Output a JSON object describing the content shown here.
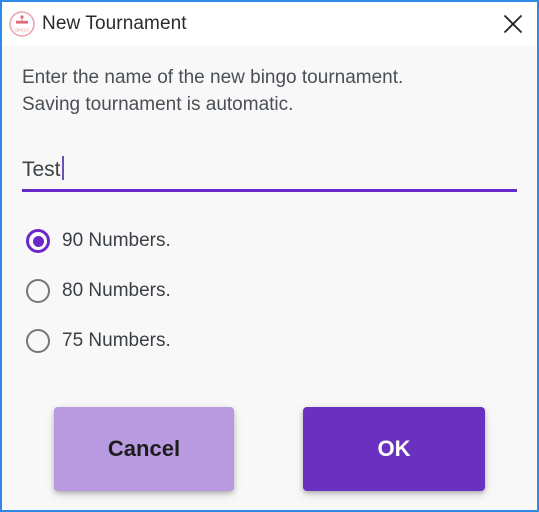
{
  "window": {
    "title": "New Tournament",
    "app_icon": "bingo-logo-icon",
    "close_icon": "close-icon",
    "border_color": "#2e8ae6",
    "titlebar_background": "#ffffff",
    "body_background": "#f8f8f8"
  },
  "dialog": {
    "prompt_line1": "Enter the name of the new bingo tournament.",
    "prompt_line2": "Saving tournament is automatic.",
    "name_field": {
      "value": "Test",
      "placeholder": "",
      "underline_color": "#6b28c8",
      "caret_visible": true
    },
    "options": [
      {
        "label": "90 Numbers.",
        "selected": true
      },
      {
        "label": "80 Numbers.",
        "selected": false
      },
      {
        "label": "75 Numbers.",
        "selected": false
      }
    ],
    "buttons": {
      "cancel_label": "Cancel",
      "ok_label": "OK",
      "cancel_color": "#b79ae0",
      "ok_color": "#6a30bf"
    }
  }
}
